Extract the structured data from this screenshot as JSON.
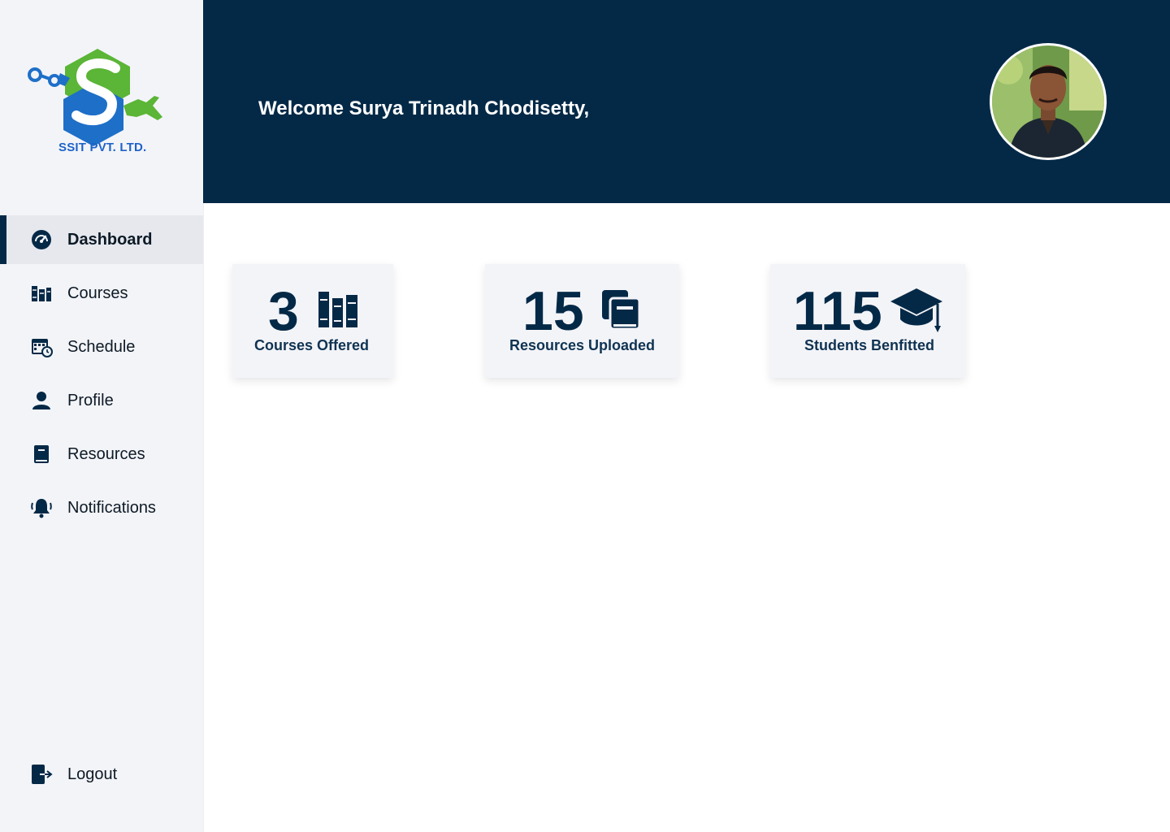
{
  "brand": {
    "company_name": "SSIT PVT. LTD.",
    "colors": {
      "primary": "#042947",
      "sidebar_bg": "#f3f4f8",
      "logo_green": "#5bb536",
      "logo_blue": "#1e6fc8"
    }
  },
  "sidebar": {
    "items": [
      {
        "label": "Dashboard",
        "icon": "dashboard-gauge-icon",
        "active": true
      },
      {
        "label": "Courses",
        "icon": "books-icon",
        "active": false
      },
      {
        "label": "Schedule",
        "icon": "calendar-clock-icon",
        "active": false
      },
      {
        "label": "Profile",
        "icon": "user-icon",
        "active": false
      },
      {
        "label": "Resources",
        "icon": "book-icon",
        "active": false
      },
      {
        "label": "Notifications",
        "icon": "bell-icon",
        "active": false
      }
    ],
    "logout": {
      "label": "Logout",
      "icon": "logout-icon"
    }
  },
  "header": {
    "welcome": "Welcome Surya Trinadh Chodisetty,",
    "avatar_icon": "user-avatar"
  },
  "stats": [
    {
      "value": "3",
      "label": "Courses Offered",
      "icon": "books-icon"
    },
    {
      "value": "15",
      "label": "Resources Uploaded",
      "icon": "copy-documents-icon"
    },
    {
      "value": "115",
      "label": "Students Benfitted",
      "icon": "graduation-cap-icon"
    }
  ]
}
